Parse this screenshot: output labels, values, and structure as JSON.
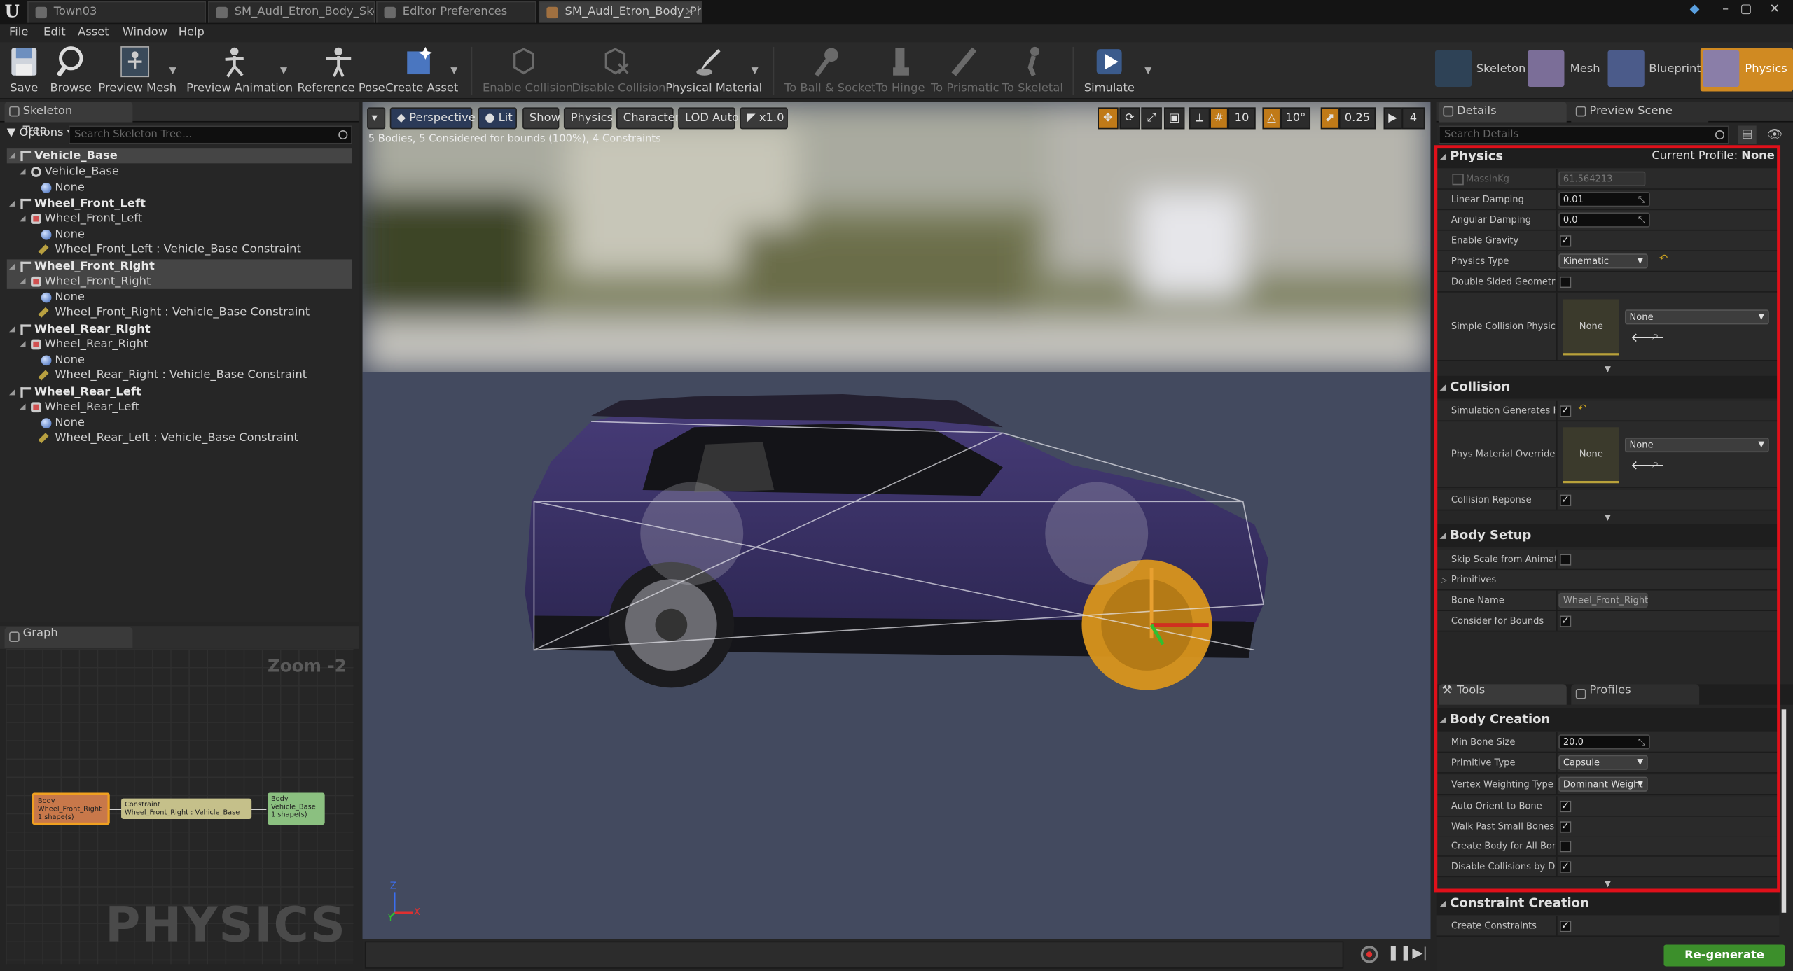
{
  "tabs": [
    "Town03",
    "SM_Audi_Etron_Body_Ske",
    "Editor Preferences",
    "SM_Audi_Etron_Body_Ph"
  ],
  "menu": [
    "File",
    "Edit",
    "Asset",
    "Window",
    "Help"
  ],
  "toolbar": {
    "save": "Save",
    "browse": "Browse",
    "preview_mesh": "Preview Mesh",
    "preview_animation": "Preview Animation",
    "reference_pose": "Reference Pose",
    "create_asset": "Create Asset",
    "enable_collision": "Enable Collision",
    "disable_collision": "Disable Collision",
    "physical_material": "Physical Material",
    "to_ball_socket": "To Ball & Socket",
    "to_hinge": "To Hinge",
    "to_prismatic": "To Prismatic",
    "to_skeletal": "To Skeletal",
    "simulate": "Simulate"
  },
  "modes": {
    "skeleton": "Skeleton",
    "mesh": "Mesh",
    "blueprint": "Blueprint",
    "physics": "Physics"
  },
  "skeleton_tree": {
    "tab": "Skeleton Tree",
    "options": "Options",
    "search_placeholder": "Search Skeleton Tree...",
    "rows": [
      "Vehicle_Base",
      "Vehicle_Base",
      "None",
      "Wheel_Front_Left",
      "Wheel_Front_Left",
      "None",
      "Wheel_Front_Left : Vehicle_Base Constraint",
      "Wheel_Front_Right",
      "Wheel_Front_Right",
      "None",
      "Wheel_Front_Right : Vehicle_Base Constraint",
      "Wheel_Rear_Right",
      "Wheel_Rear_Right",
      "None",
      "Wheel_Rear_Right : Vehicle_Base Constraint",
      "Wheel_Rear_Left",
      "Wheel_Rear_Left",
      "None",
      "Wheel_Rear_Left : Vehicle_Base Constraint"
    ]
  },
  "graph": {
    "tab": "Graph",
    "zoom": "Zoom -2",
    "watermark": "PHYSICS",
    "node1": [
      "Body",
      "Wheel_Front_Right",
      "1 shape(s)"
    ],
    "node2": [
      "Constraint",
      "Wheel_Front_Right : Vehicle_Base"
    ],
    "node3": [
      "Body",
      "Vehicle_Base",
      "1 shape(s)"
    ]
  },
  "viewport": {
    "perspective": "Perspective",
    "lit": "Lit",
    "show": "Show",
    "physics": "Physics",
    "character": "Character",
    "lod": "LOD Auto",
    "speed": "x1.0",
    "info": "5 Bodies, 5 Considered for bounds (100%), 4 Constraints",
    "grid": "10",
    "rot": "10°",
    "scale": "0.25",
    "cam": "4",
    "axis_z": "Z",
    "axis_y": "Y",
    "axis_x": "X"
  },
  "details": {
    "tab": "Details",
    "preview_tab": "Preview Scene Set",
    "search_placeholder": "Search Details",
    "physics_header": "Physics",
    "current_profile_label": "Current Profile:",
    "current_profile": "None",
    "mass_label": "MassInKg",
    "mass": "61.564213",
    "lin_damp_label": "Linear Damping",
    "lin_damp": "0.01",
    "ang_damp_label": "Angular Damping",
    "ang_damp": "0.0",
    "gravity_label": "Enable Gravity",
    "phys_type_label": "Physics Type",
    "phys_type": "Kinematic",
    "double_sided_label": "Double Sided Geometry",
    "simple_coll_label": "Simple Collision Physical M",
    "none": "None",
    "collision_header": "Collision",
    "sim_hit_label": "Simulation Generates Hit E",
    "phys_mat_label": "Phys Material Override",
    "coll_response_label": "Collision Reponse",
    "body_setup_header": "Body Setup",
    "skip_scale_label": "Skip Scale from Animation",
    "primitives_label": "Primitives",
    "bone_name_label": "Bone Name",
    "bone_name": "Wheel_Front_Right",
    "bounds_label": "Consider for Bounds",
    "tools_tab": "Tools",
    "profiles_tab": "Profiles",
    "body_creation_header": "Body Creation",
    "min_bone_label": "Min Bone Size",
    "min_bone": "20.0",
    "prim_type_label": "Primitive Type",
    "prim_type": "Capsule",
    "vertex_label": "Vertex Weighting Type",
    "vertex": "Dominant Weight",
    "auto_orient_label": "Auto Orient to Bone",
    "walk_past_label": "Walk Past Small Bones",
    "create_all_label": "Create Body for All Bones",
    "disable_coll_label": "Disable Collisions by Defa",
    "constraint_header": "Constraint Creation",
    "create_constraints_label": "Create Constraints",
    "regen": "Re-generate Bodies"
  },
  "colors": {
    "highlight": "#e0101a",
    "wheel": "#d9951c",
    "car_body": "#3e3468",
    "regen": "#3c8f2b"
  }
}
